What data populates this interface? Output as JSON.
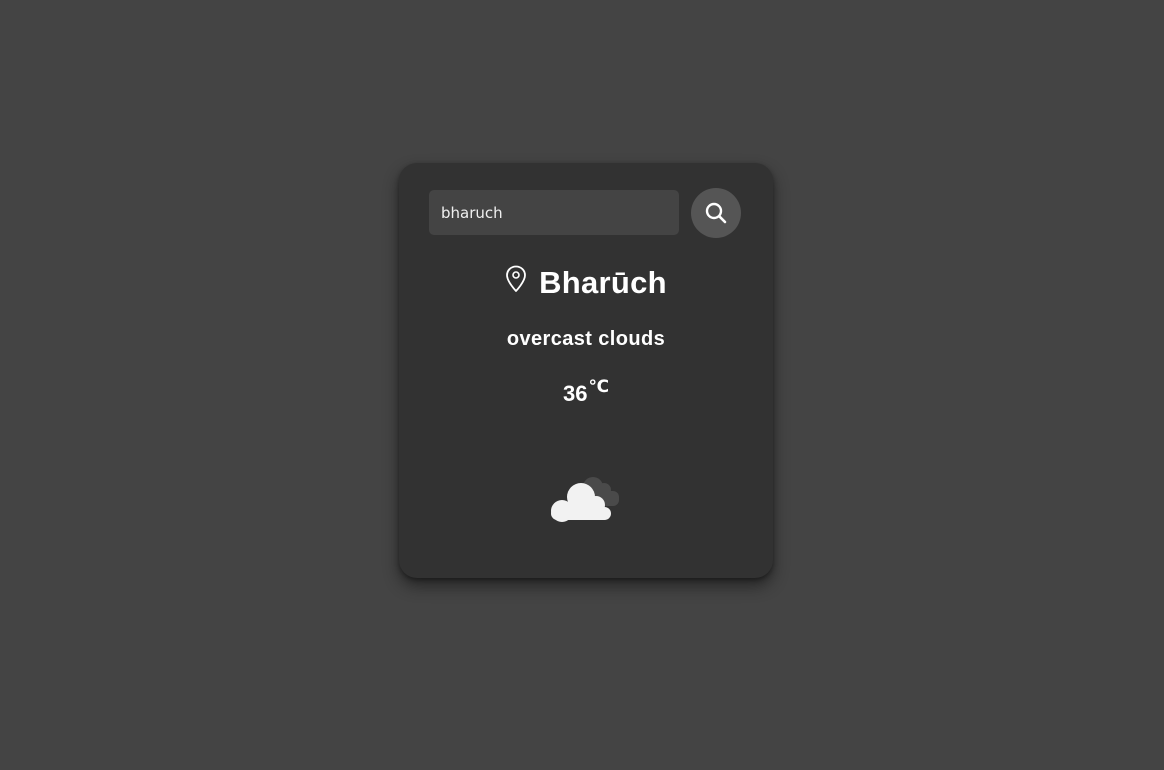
{
  "search": {
    "value": "bharuch",
    "icon": "search-icon"
  },
  "location": {
    "icon": "map-pin-icon",
    "city": "Bharūch"
  },
  "weather": {
    "description": "overcast clouds",
    "temperature": "36",
    "unit": "℃",
    "icon": "overcast-clouds-icon"
  },
  "colors": {
    "page_background": "#444444",
    "card_background": "#323232",
    "input_background": "#444444",
    "button_background": "#555555",
    "text": "#ffffff"
  }
}
